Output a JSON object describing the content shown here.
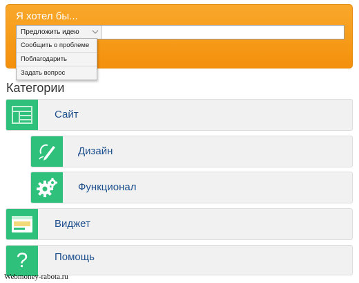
{
  "feedback": {
    "title": "Я хотел бы...",
    "select_value": "Предложить идею",
    "options": [
      "Сообщить о проблеме",
      "Поблагодарить",
      "Задать вопрос"
    ]
  },
  "categories_heading": "Категории",
  "categories": [
    {
      "label": "Сайт",
      "icon": "layout-icon"
    },
    {
      "label": "Дизайн",
      "icon": "pen-icon"
    },
    {
      "label": "Функционал",
      "icon": "gears-icon"
    },
    {
      "label": "Виджет",
      "icon": "widget-icon"
    },
    {
      "label": "Помощь",
      "icon": "question-icon"
    }
  ],
  "watermark": "Webmoney-rabota.ru",
  "colors": {
    "panel": "#f4900c",
    "icon_bg": "#2fc17c",
    "label": "#1d4f8c"
  }
}
